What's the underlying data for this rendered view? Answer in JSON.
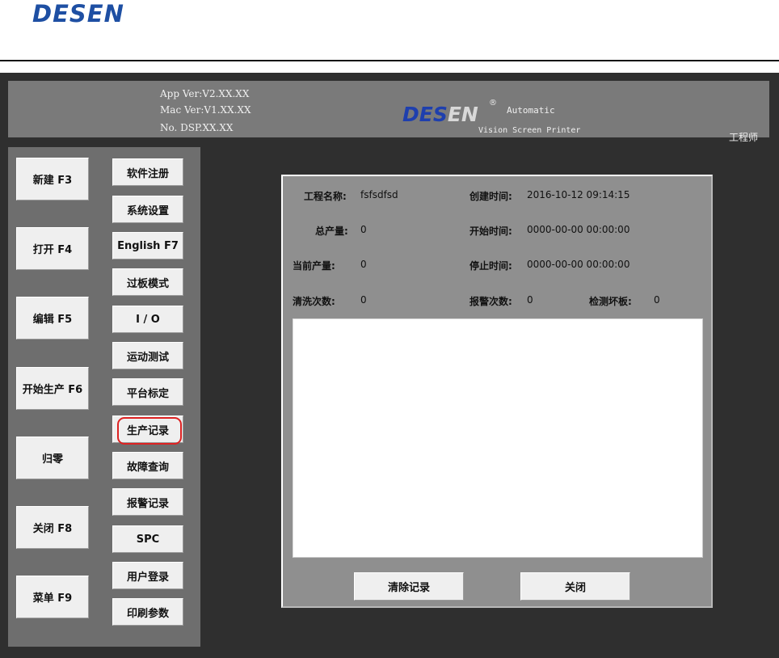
{
  "doc_header": {
    "logo": "DESEN"
  },
  "app_header": {
    "app_ver": "App Ver:V2.XX.XX",
    "mac_ver": "Mac Ver:V1.XX.XX",
    "dsp_no": "No. DSP.XX.XX",
    "logo_des": "DES",
    "logo_en": "EN",
    "logo_reg": "®",
    "automatic": "Automatic",
    "subtitle": "Vision Screen Printer",
    "user_role": "工程师"
  },
  "left_buttons": [
    {
      "label": "新建 F3"
    },
    {
      "label": "打开 F4"
    },
    {
      "label": "编辑 F5"
    },
    {
      "label": "开始生产 F6"
    },
    {
      "label": "归零"
    },
    {
      "label": "关闭 F8"
    },
    {
      "label": "菜单 F9"
    }
  ],
  "menu_buttons": [
    {
      "label": "软件注册"
    },
    {
      "label": "系统设置"
    },
    {
      "label": "English F7"
    },
    {
      "label": "过板模式"
    },
    {
      "label": "I / O"
    },
    {
      "label": "运动测试"
    },
    {
      "label": "平台标定"
    },
    {
      "label": "生产记录",
      "highlighted": true
    },
    {
      "label": "故障查询"
    },
    {
      "label": "报警记录"
    },
    {
      "label": "SPC"
    },
    {
      "label": "用户登录"
    },
    {
      "label": "印刷参数"
    }
  ],
  "record_dialog": {
    "project_name_label": "工程名称:",
    "project_name_value": "fsfsdfsd",
    "create_time_label": "创建时间:",
    "create_time_value": "2016-10-12 09:14:15",
    "total_output_label": "总产量:",
    "total_output_value": "0",
    "start_time_label": "开始时间:",
    "start_time_value": "0000-00-00 00:00:00",
    "current_output_label": "当前产量:",
    "current_output_value": "0",
    "stop_time_label": "停止时间:",
    "stop_time_value": "0000-00-00 00:00:00",
    "clean_count_label": "清洗次数:",
    "clean_count_value": "0",
    "alarm_count_label": "报警次数:",
    "alarm_count_value": "0",
    "bad_board_label": "检测坏板:",
    "bad_board_value": "0",
    "clear_button": "清除记录",
    "close_button": "关闭"
  },
  "colors": {
    "highlight": "#dd2222",
    "logo_blue": "#1e3fae"
  }
}
